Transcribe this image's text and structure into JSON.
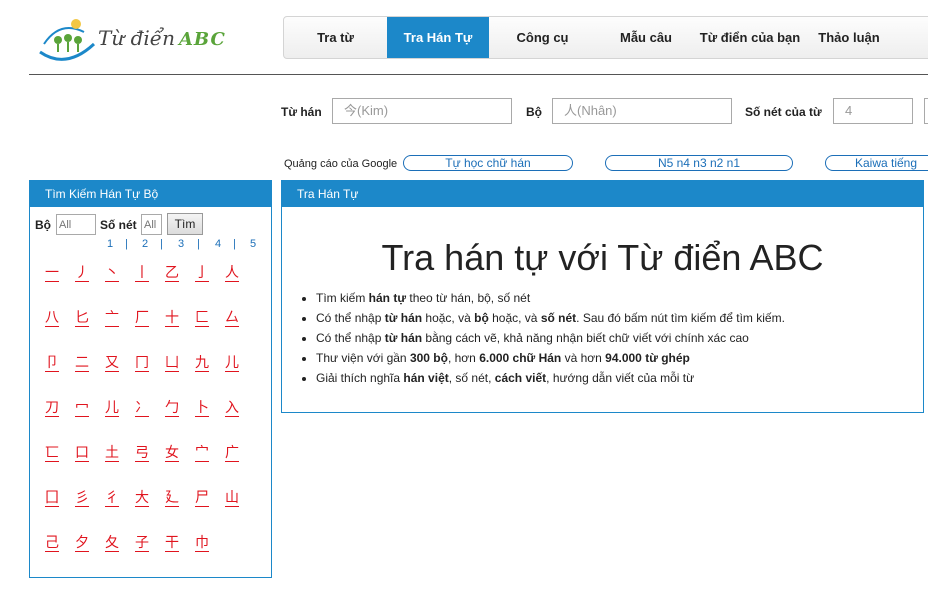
{
  "logo": {
    "text": "Từ điển",
    "brand": "ABC"
  },
  "nav": [
    {
      "label": "Tra từ",
      "active": false
    },
    {
      "label": "Tra Hán Tự",
      "active": true
    },
    {
      "label": "Công cụ",
      "active": false
    },
    {
      "label": "Mẫu câu",
      "active": false
    },
    {
      "label": "Từ điển của bạn",
      "active": false
    },
    {
      "label": "Thảo luận",
      "active": false
    }
  ],
  "search": {
    "tuhan_label": "Từ hán",
    "tuhan_placeholder": "今(Kim)",
    "bo_label": "Bộ",
    "bo_placeholder": "人(Nhân)",
    "sonet_label": "Số nét của từ",
    "sonet_placeholder": "4"
  },
  "ads": {
    "label": "Quảng cáo của Google",
    "links": [
      "Tự học chữ hán",
      "N5 n4 n3 n2 n1",
      "Kaiwa tiếng"
    ]
  },
  "left_panel": {
    "title": "Tìm Kiếm Hán Tự Bộ",
    "bo_label": "Bộ",
    "bo_value": "All",
    "sonet_label": "Số nét",
    "sonet_value": "All",
    "button": "Tìm",
    "pages": [
      "1",
      "2",
      "3",
      "4",
      "5"
    ],
    "radicals": [
      [
        "一",
        "丿",
        "丶",
        "丨",
        "乙",
        "亅",
        "人"
      ],
      [
        "八",
        "匕",
        "亠",
        "厂",
        "十",
        "匚",
        "厶"
      ],
      [
        "卩",
        "二",
        "又",
        "冂",
        "凵",
        "九",
        "儿"
      ],
      [
        "刀",
        "冖",
        "儿",
        "冫",
        "勹",
        "卜",
        "入"
      ],
      [
        "匸",
        "口",
        "土",
        "弓",
        "女",
        "宀",
        "广"
      ],
      [
        "囗",
        "彡",
        "彳",
        "大",
        "廴",
        "尸",
        "山"
      ],
      [
        "己",
        "夕",
        "夂",
        "子",
        "干",
        "巾"
      ]
    ]
  },
  "right_panel": {
    "title": "Tra Hán Tự",
    "heading": "Tra hán tự với Từ điển ABC",
    "bullets": [
      [
        {
          "t": "Tìm kiếm "
        },
        {
          "t": "hán tự",
          "b": true
        },
        {
          "t": " theo từ hán, bộ, số nét"
        }
      ],
      [
        {
          "t": "Có thể nhập "
        },
        {
          "t": "từ hán",
          "b": true
        },
        {
          "t": " hoặc, và "
        },
        {
          "t": "bộ",
          "b": true
        },
        {
          "t": " hoặc, và "
        },
        {
          "t": "số nét",
          "b": true
        },
        {
          "t": ". Sau đó bấm nút tìm kiếm để tìm kiếm."
        }
      ],
      [
        {
          "t": "Có thể nhập "
        },
        {
          "t": "từ hán",
          "b": true
        },
        {
          "t": " bằng cách vẽ, khả năng nhận biết chữ viết với chính xác cao"
        }
      ],
      [
        {
          "t": "Thư viện với gần "
        },
        {
          "t": "300 bộ",
          "b": true
        },
        {
          "t": ", hơn "
        },
        {
          "t": "6.000 chữ Hán",
          "b": true
        },
        {
          "t": " và hơn "
        },
        {
          "t": "94.000 từ ghép",
          "b": true
        }
      ],
      [
        {
          "t": "Giải thích nghĩa "
        },
        {
          "t": "hán việt",
          "b": true
        },
        {
          "t": ", số nét, "
        },
        {
          "t": "cách viết",
          "b": true
        },
        {
          "t": ", hướng dẫn viết của mỗi từ"
        }
      ]
    ]
  },
  "colors": {
    "accent": "#1c88c9",
    "radical": "#e0141e",
    "link": "#1c6fb8"
  }
}
